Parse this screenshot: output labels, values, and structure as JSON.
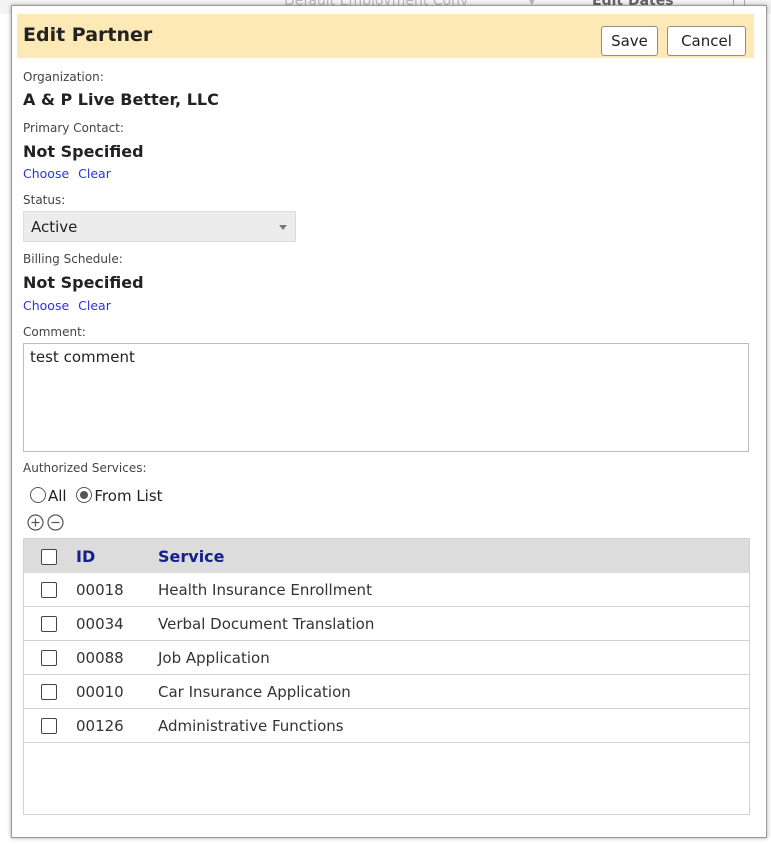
{
  "background": {
    "peek_text": "Default Employment Conv",
    "peek_right": "Edit Dates"
  },
  "dialog": {
    "title": "Edit Partner",
    "save_label": "Save",
    "cancel_label": "Cancel",
    "organization_label": "Organization:",
    "organization_value": "A & P Live Better, LLC",
    "primary_contact_label": "Primary Contact:",
    "primary_contact_value": "Not Specified",
    "choose_label": "Choose",
    "clear_label": "Clear",
    "status_label": "Status:",
    "status_value": "Active",
    "billing_label": "Billing Schedule:",
    "billing_value": "Not Specified",
    "comment_label": "Comment:",
    "comment_value": "test comment",
    "services_label": "Authorized Services:",
    "radio_all": "All",
    "radio_from_list": "From List",
    "selected_radio": "from_list"
  },
  "grid": {
    "columns": {
      "id": "ID",
      "service": "Service"
    },
    "rows": [
      {
        "id": "00018",
        "service": "Health Insurance Enrollment"
      },
      {
        "id": "00034",
        "service": "Verbal Document Translation"
      },
      {
        "id": "00088",
        "service": "Job Application"
      },
      {
        "id": "00010",
        "service": "Car Insurance Application"
      },
      {
        "id": "00126",
        "service": "Administrative Functions"
      }
    ]
  },
  "colors": {
    "header_bg": "#fde9b5",
    "link": "#2a35d8",
    "grid_header_text": "#141e8c"
  }
}
